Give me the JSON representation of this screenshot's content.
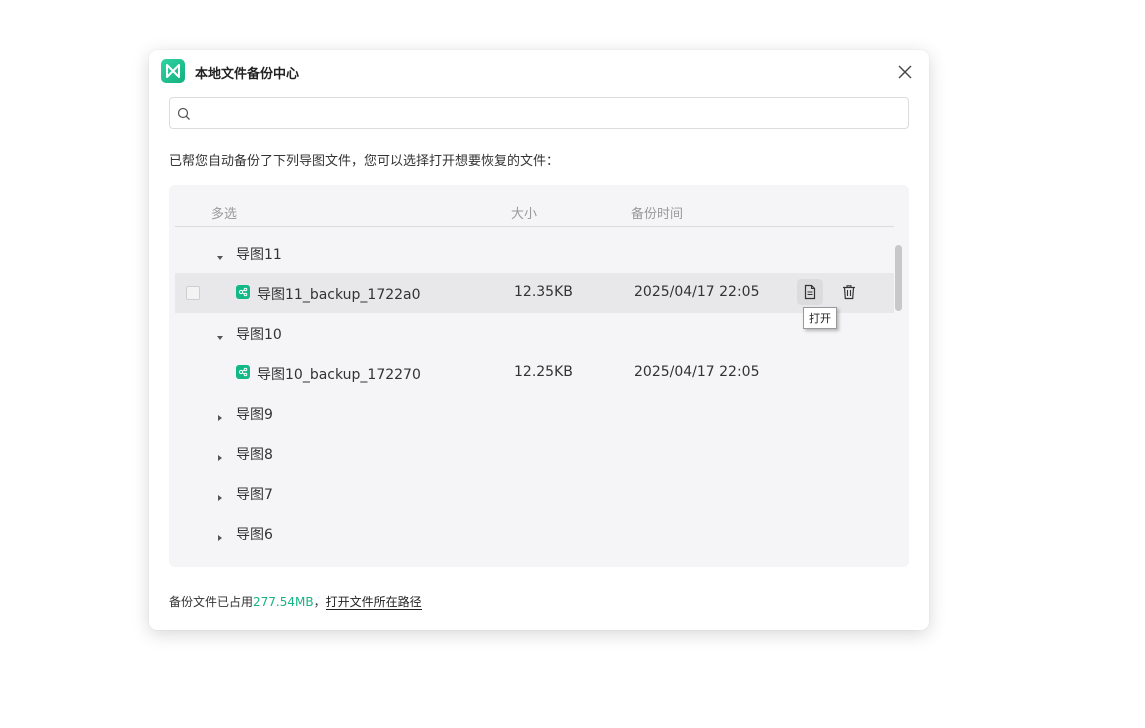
{
  "dialog": {
    "title": "本地文件备份中心",
    "description": "已帮您自动备份了下列导图文件，您可以选择打开想要恢复的文件：",
    "search": {
      "value": "",
      "placeholder": ""
    }
  },
  "table": {
    "headers": {
      "select": "多选",
      "size": "大小",
      "time": "备份时间"
    }
  },
  "groups": [
    {
      "label": "导图11",
      "expanded": true,
      "file": {
        "name": "导图11_backup_1722a0",
        "size": "12.35KB",
        "time": "2025/04/17 22:05"
      }
    },
    {
      "label": "导图10",
      "expanded": true,
      "file": {
        "name": "导图10_backup_172270",
        "size": "12.25KB",
        "time": "2025/04/17 22:05"
      }
    },
    {
      "label": "导图9",
      "expanded": false
    },
    {
      "label": "导图8",
      "expanded": false
    },
    {
      "label": "导图7",
      "expanded": false
    },
    {
      "label": "导图6",
      "expanded": false
    }
  ],
  "tooltip": {
    "open": "打开"
  },
  "footer": {
    "prefix": "备份文件已占用",
    "used": "277.54MB",
    "separator": "，",
    "link": "打开文件所在路径"
  },
  "colors": {
    "accent": "#16b383",
    "panel_bg": "#f5f5f7",
    "hover_row": "#e8e8ea"
  },
  "icons": {
    "logo": "app-logo-icon",
    "close": "close-icon",
    "search": "search-icon",
    "expand": "caret-down-icon",
    "collapse": "caret-right-icon",
    "file": "mindmap-file-icon",
    "open": "document-icon",
    "delete": "trash-icon"
  }
}
